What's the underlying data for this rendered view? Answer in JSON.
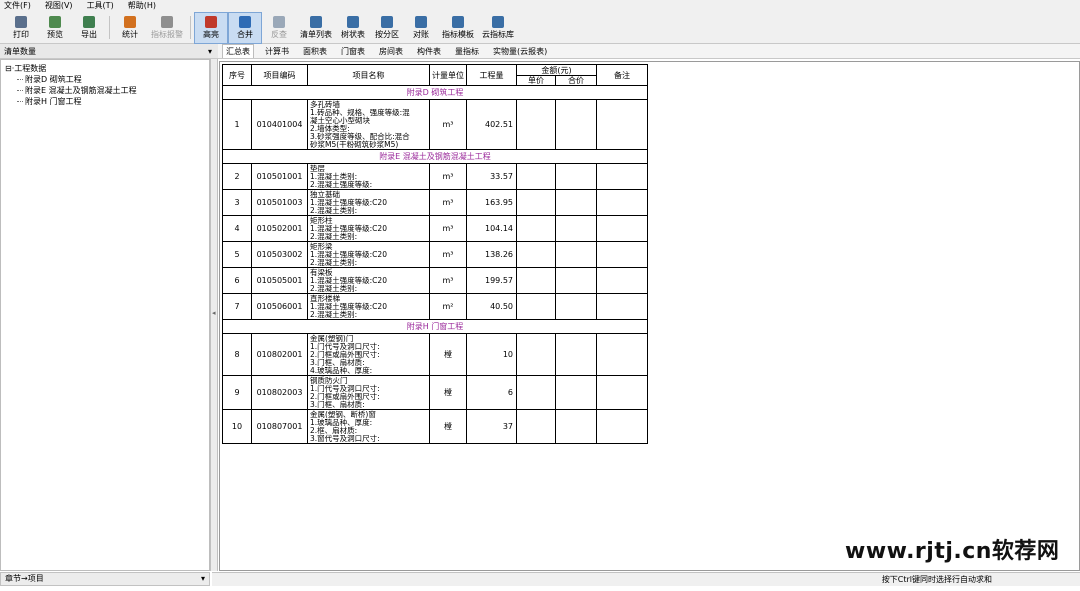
{
  "menubar": [
    "文件(F)",
    "视图(V)",
    "工具(T)",
    "帮助(H)"
  ],
  "toolbar": {
    "buttons": [
      {
        "label": "打印",
        "icon": "printer-icon",
        "color": "#5a6f8c",
        "disabled": false,
        "active": false
      },
      {
        "label": "预览",
        "icon": "preview-icon",
        "color": "#4f8a4f",
        "disabled": false,
        "active": false
      },
      {
        "label": "导出",
        "icon": "export-icon",
        "color": "#3f7f4f",
        "disabled": false,
        "active": false
      },
      {
        "label": "统计",
        "icon": "statistics-icon",
        "color": "#d2701e",
        "disabled": false,
        "active": false
      },
      {
        "label": "指标报警",
        "icon": "indicator-alarm-icon",
        "color": "#8f8f8f",
        "disabled": true,
        "active": false
      },
      {
        "label": "高亮",
        "icon": "highlight-icon",
        "color": "#c0392b",
        "disabled": false,
        "active": true
      },
      {
        "label": "合并",
        "icon": "merge-icon",
        "color": "#2e6bb5",
        "disabled": false,
        "active": true
      },
      {
        "label": "反查",
        "icon": "reverse-lookup-icon",
        "color": "#9aa8b8",
        "disabled": true,
        "active": false
      },
      {
        "label": "清单列表",
        "icon": "bill-list-icon",
        "color": "#3a6ea5",
        "disabled": false,
        "active": false
      },
      {
        "label": "树状表",
        "icon": "tree-table-icon",
        "color": "#3a6ea5",
        "disabled": false,
        "active": false
      },
      {
        "label": "按分区",
        "icon": "partition-icon",
        "color": "#3a6ea5",
        "disabled": false,
        "active": false
      },
      {
        "label": "对账",
        "icon": "reconcile-icon",
        "color": "#3a6ea5",
        "disabled": false,
        "active": false
      },
      {
        "label": "指标模板",
        "icon": "indicator-template-icon",
        "color": "#3a6ea5",
        "disabled": false,
        "active": false
      },
      {
        "label": "云指标库",
        "icon": "cloud-indicator-icon",
        "color": "#3a6ea5",
        "disabled": false,
        "active": false
      }
    ]
  },
  "left_panel": {
    "header": "清单数量",
    "tree": {
      "root": "工程数据",
      "children": [
        "附录D 砌筑工程",
        "附录E 混凝土及钢筋混凝土工程",
        "附录H 门窗工程"
      ]
    },
    "status": "章节→项目"
  },
  "tabs": [
    "汇总表",
    "计算书",
    "面积表",
    "门窗表",
    "房间表",
    "构件表",
    "量指标",
    "实物量(云报表)"
  ],
  "table": {
    "headers": {
      "seq": "序号",
      "code": "项目编码",
      "name": "项目名称",
      "unit": "计量单位",
      "qty": "工程量",
      "amount": "金额(元)",
      "unit_price": "单价",
      "total": "合价",
      "remark": "备注"
    },
    "sections": [
      {
        "title": "附录D 砌筑工程",
        "rows": [
          {
            "seq": "1",
            "code": "010401004",
            "desc": [
              "多孔砖墙",
              "1.砖品种、规格、强度等级:混",
              "凝土空心小型砌块",
              "2.墙体类型:",
              "3.砂浆强度等级、配合比:混合",
              "砂浆M5(干粉砌筑砂浆M5)"
            ],
            "unit": "m³",
            "qty": "402.51"
          }
        ]
      },
      {
        "title": "附录E 混凝土及钢筋混凝土工程",
        "rows": [
          {
            "seq": "2",
            "code": "010501001",
            "desc": [
              "垫层",
              "1.混凝土类别:",
              "2.混凝土强度等级:"
            ],
            "unit": "m³",
            "qty": "33.57"
          },
          {
            "seq": "3",
            "code": "010501003",
            "desc": [
              "独立基础",
              "1.混凝土强度等级:C20",
              "2.混凝土类别:"
            ],
            "unit": "m³",
            "qty": "163.95"
          },
          {
            "seq": "4",
            "code": "010502001",
            "desc": [
              "矩形柱",
              "1.混凝土强度等级:C20",
              "2.混凝土类别:"
            ],
            "unit": "m³",
            "qty": "104.14"
          },
          {
            "seq": "5",
            "code": "010503002",
            "desc": [
              "矩形梁",
              "1.混凝土强度等级:C20",
              "2.混凝土类别:"
            ],
            "unit": "m³",
            "qty": "138.26"
          },
          {
            "seq": "6",
            "code": "010505001",
            "desc": [
              "有梁板",
              "1.混凝土强度等级:C20",
              "2.混凝土类别:"
            ],
            "unit": "m³",
            "qty": "199.57"
          },
          {
            "seq": "7",
            "code": "010506001",
            "desc": [
              "直形楼梯",
              "1.混凝土强度等级:C20",
              "2.混凝土类别:"
            ],
            "unit": "m²",
            "qty": "40.50"
          }
        ]
      },
      {
        "title": "附录H 门窗工程",
        "rows": [
          {
            "seq": "8",
            "code": "010802001",
            "desc": [
              "金属(塑钢)门",
              "1.门代号及洞口尺寸:",
              "2.门框或扇外围尺寸:",
              "3.门框、扇材质:",
              "4.玻璃品种、厚度:"
            ],
            "unit": "樘",
            "qty": "10"
          },
          {
            "seq": "9",
            "code": "010802003",
            "desc": [
              "钢质防火门",
              "1.门代号及洞口尺寸:",
              "2.门框或扇外围尺寸:",
              "3.门框、扇材质:"
            ],
            "unit": "樘",
            "qty": "6"
          },
          {
            "seq": "10",
            "code": "010807001",
            "desc": [
              "金属(塑钢、断桥)窗",
              "1.玻璃品种、厚度:",
              "2.框、扇材质:",
              "3.窗代号及洞口尺寸:"
            ],
            "unit": "樘",
            "qty": "37"
          }
        ]
      }
    ]
  },
  "status_hint": "按下Ctrl键同时选择行自动求和",
  "watermark": "www.rjtj.cn软荐网",
  "colors": {
    "section_title": "#9b2a9b",
    "active_button": "#c9dcf2"
  }
}
